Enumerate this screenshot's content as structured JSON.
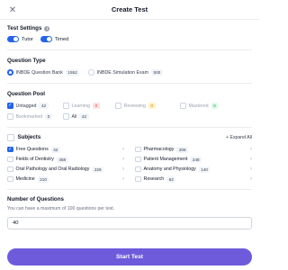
{
  "header": {
    "title": "Create Test",
    "close_icon": "close-icon"
  },
  "test_settings": {
    "title": "Test Settings",
    "info_icon": "info-icon",
    "tutor_label": "Tutor",
    "timed_label": "Timed"
  },
  "question_type": {
    "title": "Question Type",
    "options": [
      {
        "label": "INBDE Question Bank",
        "count": "1552",
        "selected": true
      },
      {
        "label": "INBDE Simulation Exam",
        "count": "500",
        "selected": false
      }
    ]
  },
  "question_pool": {
    "title": "Question Pool",
    "options": [
      {
        "label": "Untagged",
        "count": "42",
        "checked": true
      },
      {
        "label": "Learning",
        "count": "0"
      },
      {
        "label": "Reviewing",
        "count": "0"
      },
      {
        "label": "Mastered",
        "count": "0"
      },
      {
        "label": "Bookmarked",
        "count": "0"
      },
      {
        "label": "All",
        "count": "42"
      }
    ]
  },
  "subjects": {
    "title": "Subjects",
    "expand_label": "+ Expand All",
    "items": [
      {
        "name": "Free Questions",
        "count": "42",
        "checked": true
      },
      {
        "name": "Pharmacology",
        "count": "206"
      },
      {
        "name": "Fields of Dentistry",
        "count": "458"
      },
      {
        "name": "Patient Management",
        "count": "248"
      },
      {
        "name": "Oral Pathology and Oral Radiology",
        "count": "226"
      },
      {
        "name": "Anatomy and Physiology",
        "count": "140"
      },
      {
        "name": "Medicine",
        "count": "210"
      },
      {
        "name": "Research",
        "count": "62"
      }
    ]
  },
  "num_questions": {
    "title": "Number of Questions",
    "helper": "You can have a maximum of 100 questions per test.",
    "value": "40"
  },
  "start_button": {
    "label": "Start Test"
  },
  "colors": {
    "accent": "#2563eb",
    "start_button": "#6d5bdc"
  }
}
